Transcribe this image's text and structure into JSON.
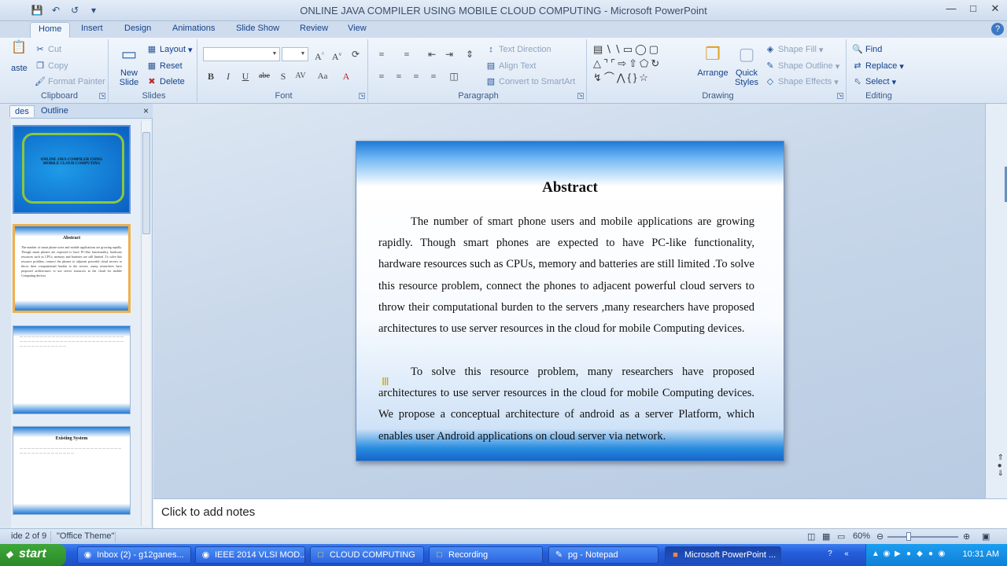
{
  "window": {
    "title": "ONLINE JAVA COMPILER USING MOBILE CLOUD COMPUTING - Microsoft PowerPoint"
  },
  "quick_access": [
    "save-icon",
    "undo-icon",
    "redo-icon",
    "customize-icon"
  ],
  "tabs": [
    {
      "label": "Home",
      "active": true
    },
    {
      "label": "Insert"
    },
    {
      "label": "Design"
    },
    {
      "label": "Animations"
    },
    {
      "label": "Slide Show"
    },
    {
      "label": "Review"
    },
    {
      "label": "View"
    }
  ],
  "ribbon": {
    "clipboard": {
      "label": "Clipboard",
      "paste": "aste",
      "cut": "Cut",
      "copy": "Copy",
      "format_painter": "Format Painter"
    },
    "slides": {
      "label": "Slides",
      "new_slide": "New Slide",
      "layout": "Layout",
      "reset": "Reset",
      "delete": "Delete"
    },
    "font": {
      "label": "Font"
    },
    "paragraph": {
      "label": "Paragraph",
      "text_direction": "Text Direction",
      "align_text": "Align Text",
      "convert_smartart": "Convert to SmartArt"
    },
    "drawing": {
      "label": "Drawing",
      "arrange": "Arrange",
      "quick_styles": "Quick Styles",
      "shape_fill": "Shape Fill",
      "shape_outline": "Shape Outline",
      "shape_effects": "Shape Effects"
    },
    "editing": {
      "label": "Editing",
      "find": "Find",
      "replace": "Replace",
      "select": "Select"
    }
  },
  "panel": {
    "tab_slides": "des",
    "tab_outline": "Outline",
    "thumbnails": [
      {
        "title": "ONLINE JAVA COMPILER USING MOBILE CLOUD COMPUTING"
      },
      {
        "title": "Abstract"
      },
      {
        "title": ""
      },
      {
        "title": "Existing System"
      }
    ]
  },
  "slide": {
    "title": "Abstract",
    "paragraph1": "The number of smart phone users and mobile applications are growing rapidly. Though smart phones are expected to have PC-like functionality, hardware resources such as CPUs, memory and batteries are still limited .To solve this resource problem, connect the phones to adjacent powerful cloud servers to throw their computational burden to the servers ,many researchers have proposed architectures to use server resources in the cloud for mobile Computing devices.",
    "paragraph2": "To solve this resource problem, many researchers have proposed architectures to use server resources in the cloud for mobile Computing devices. We propose a conceptual architecture of android as a server Platform, which enables user Android applications on cloud server via network."
  },
  "notes": {
    "placeholder": "Click to add notes"
  },
  "status": {
    "slide_info": "ide 2 of 9",
    "theme": "\"Office Theme\"",
    "zoom": "60%",
    "zoom_level": 0.6
  },
  "taskbar": {
    "start": "start",
    "tasks": [
      {
        "label": "Inbox (2) - g12ganes...",
        "icon": "chrome-icon"
      },
      {
        "label": "IEEE 2014 VLSI MOD...",
        "icon": "chrome-icon"
      },
      {
        "label": "CLOUD COMPUTING",
        "icon": "folder-icon"
      },
      {
        "label": "Recording",
        "icon": "folder-icon"
      },
      {
        "label": "pg - Notepad",
        "icon": "notepad-icon"
      },
      {
        "label": "Microsoft PowerPoint ...",
        "icon": "powerpoint-icon",
        "active": true
      }
    ],
    "clock": "10:31 AM"
  }
}
